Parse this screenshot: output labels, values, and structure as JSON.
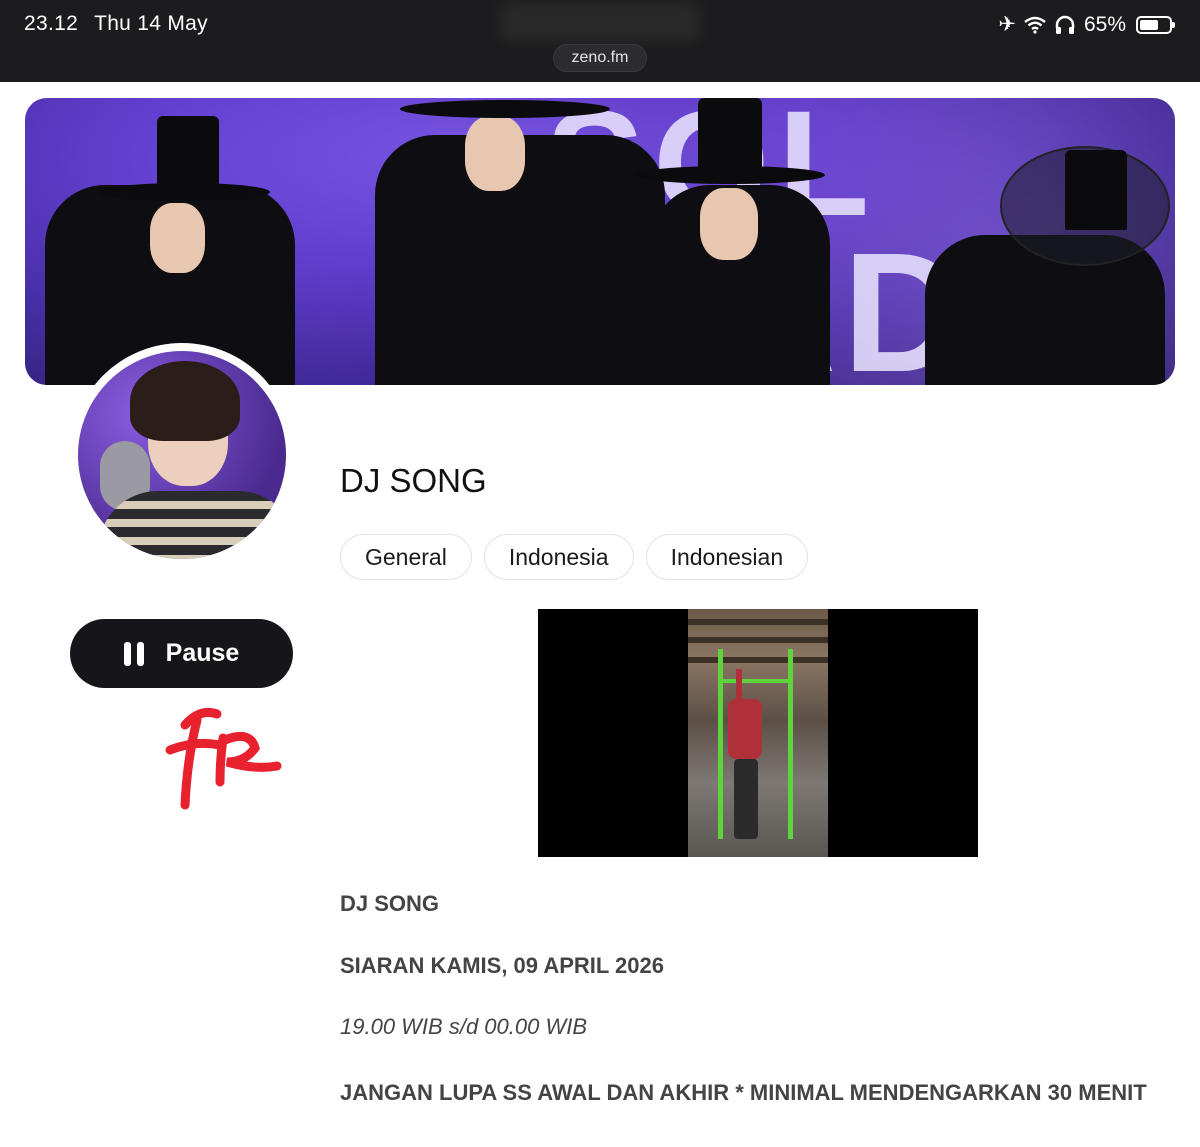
{
  "status_bar": {
    "time": "23.12",
    "date": "Thu 14 May",
    "battery_percent": "65%",
    "url": "zeno.fm"
  },
  "banner": {
    "background_text_1": "SOL",
    "background_text_2": "RADIO"
  },
  "station": {
    "title": "DJ SONG",
    "tags": [
      "General",
      "Indonesia",
      "Indonesian"
    ]
  },
  "player": {
    "pause_label": "Pause"
  },
  "description": {
    "line1": "DJ SONG",
    "line2": "SIARAN KAMIS, 09 APRIL 2026",
    "line3": "19.00 WIB s/d 00.00 WIB",
    "line4": "JANGAN LUPA SS AWAL DAN AKHIR * MINIMAL MENDENGARKAN 30 MENIT"
  },
  "colors": {
    "status_bar": "#1c1c1e",
    "banner_purple": "#5b36c4",
    "button_dark": "#16161a",
    "signature_red": "#e8212e",
    "rack_green": "#5fd33b"
  }
}
